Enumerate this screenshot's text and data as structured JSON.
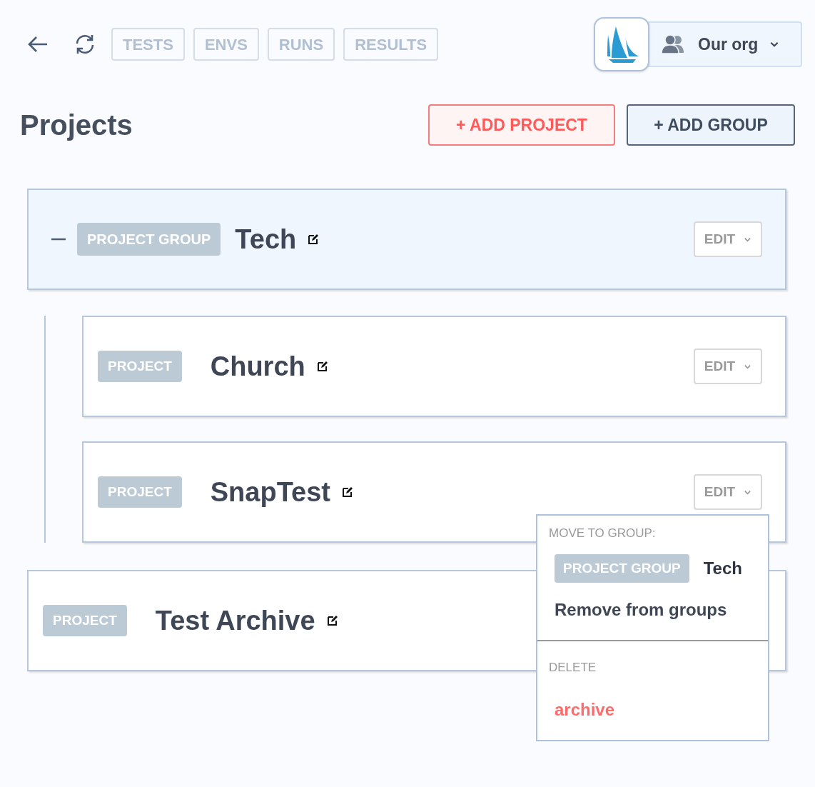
{
  "nav": {
    "tabs": [
      {
        "label": "TESTS"
      },
      {
        "label": "ENVS"
      },
      {
        "label": "RUNS"
      },
      {
        "label": "RESULTS"
      }
    ],
    "org": "Our org"
  },
  "page": {
    "title": "Projects",
    "actions": [
      {
        "kind": "primary",
        "label": "+ ADD PROJECT"
      },
      {
        "kind": "secondary",
        "label": "+ ADD GROUP"
      }
    ]
  },
  "items": [
    {
      "kind": "group",
      "badge": "PROJECT GROUP",
      "name": "Tech",
      "expanded": true,
      "edit": "EDIT",
      "children": [
        {
          "kind": "project",
          "badge": "PROJECT",
          "name": "Church",
          "edit": "EDIT"
        },
        {
          "kind": "project",
          "badge": "PROJECT",
          "name": "SnapTest",
          "edit": "EDIT",
          "menu": {
            "move_heading": "MOVE TO GROUP:",
            "groups": [
              {
                "badge": "PROJECT GROUP",
                "name": "Tech"
              }
            ],
            "remove": "Remove from groups",
            "delete_heading": "DELETE",
            "delete_action": "archive"
          }
        }
      ]
    },
    {
      "kind": "project",
      "badge": "PROJECT",
      "name": "Test Archive"
    }
  ]
}
